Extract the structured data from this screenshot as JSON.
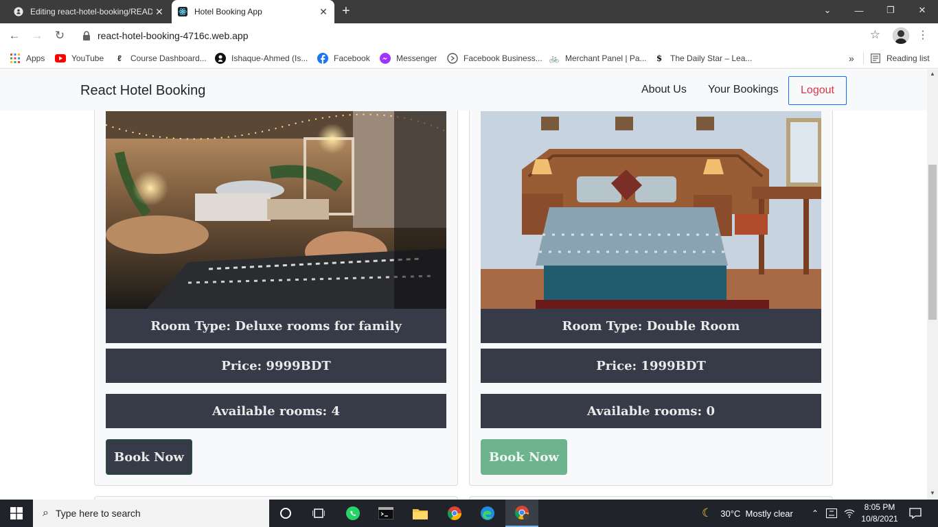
{
  "browser": {
    "tabs": [
      {
        "title": "Editing react-hotel-booking/README.md"
      },
      {
        "title": "Hotel Booking App"
      }
    ],
    "url": "react-hotel-booking-4716c.web.app",
    "bookmarks": [
      {
        "label": "Apps",
        "icon": "apps-grid-icon"
      },
      {
        "label": "YouTube",
        "icon": "youtube-icon"
      },
      {
        "label": "Course Dashboard...",
        "icon": "course-icon"
      },
      {
        "label": "Ishaque-Ahmed (Is...",
        "icon": "github-icon"
      },
      {
        "label": "Facebook",
        "icon": "facebook-icon"
      },
      {
        "label": "Messenger",
        "icon": "messenger-icon"
      },
      {
        "label": "Facebook Business...",
        "icon": "facebook-business-icon"
      },
      {
        "label": "Merchant Panel | Pa...",
        "icon": "merchant-icon"
      },
      {
        "label": "The Daily Star – Lea...",
        "icon": "daily-star-icon"
      }
    ],
    "more_bookmarks": "»",
    "reading_list": "Reading list"
  },
  "site": {
    "brand": "React Hotel Booking",
    "nav": {
      "about": "About Us",
      "bookings": "Your Bookings",
      "logout": "Logout"
    }
  },
  "rooms": [
    {
      "type": "Room Type: Deluxe rooms for family",
      "price": "Price: 9999BDT",
      "available": "Available rooms: 4",
      "button": "Book Now",
      "button_state": "enabled"
    },
    {
      "type": "Room Type: Double Room",
      "price": "Price: 1999BDT",
      "available": "Available rooms: 0",
      "button": "Book Now",
      "button_state": "disabled"
    }
  ],
  "taskbar": {
    "search_placeholder": "Type here to search",
    "weather": "30°C  Mostly clear",
    "time": "8:05 PM",
    "date": "10/8/2021"
  },
  "colors": {
    "accent": "#0d6efd",
    "logout": "#dc3545",
    "card_bar": "#373b48",
    "disabled_button": "#6db38d"
  }
}
